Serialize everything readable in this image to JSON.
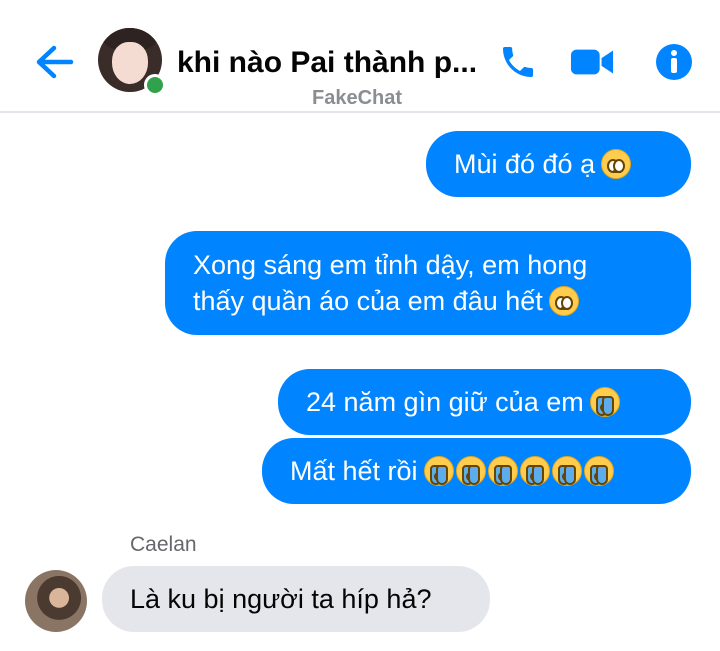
{
  "header": {
    "title": "khi nào Pai thành p...",
    "subtitle": "FakeChat",
    "icons": [
      "back-arrow-icon",
      "phone-icon",
      "video-camera-icon",
      "info-icon"
    ],
    "accent_color": "#0084ff",
    "online_color": "#31a24c"
  },
  "messages": {
    "m1": "Mùi đó đó ạ",
    "m2_line1": "Xong sáng em tỉnh dậy, em hong",
    "m2_line2": "thấy quần áo của em đâu hết",
    "m3": "24 năm gìn giữ của em",
    "m4": "Mất hết rồi",
    "sender": "Caelan",
    "m5": "Là ku bị người ta híp hả?"
  },
  "colors": {
    "outgoing_bubble": "#0084ff",
    "incoming_bubble": "#e4e6eb"
  }
}
